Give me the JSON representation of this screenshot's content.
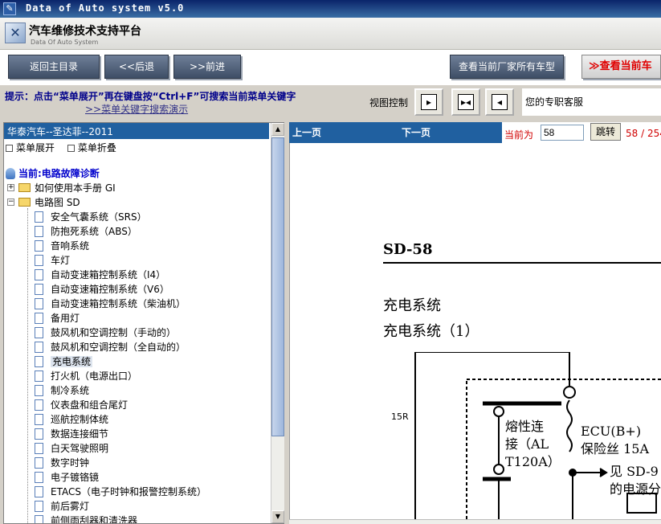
{
  "window": {
    "title": "Data of Auto system v5.0"
  },
  "header": {
    "title": "汽车维修技术支持平台",
    "subtitle": "Data Of Auto System"
  },
  "toolbar": {
    "home_label": "返回主目录",
    "back_label": "<<后退",
    "forward_label": ">>前进",
    "all_models_label": "查看当前厂家所有车型",
    "current_model_label": "查看当前车"
  },
  "hint": {
    "text": "提示：点击“菜单展开”再在键盘按“Ctrl+F”可搜索当前菜单关键字",
    "link": ">>菜单关键字搜索演示"
  },
  "view_control": {
    "label": "视图控制",
    "btn1": "▸",
    "btn2": "▸◂",
    "btn3": "◂"
  },
  "service_label": "您的专职客服",
  "left_panel": {
    "car_title": "华泰汽车--圣达菲--2011",
    "expand_label": "菜单展开",
    "collapse_label": "菜单折叠",
    "current_label": "当前:电路故障诊断",
    "nodes": [
      {
        "label": "如何使用本手册 GI"
      },
      {
        "label": "电路图 SD"
      }
    ],
    "items": [
      {
        "label": "安全气囊系统（SRS）"
      },
      {
        "label": "防抱死系统（ABS）"
      },
      {
        "label": "音响系统"
      },
      {
        "label": "车灯"
      },
      {
        "label": "自动变速箱控制系统（I4）"
      },
      {
        "label": "自动变速箱控制系统（V6）"
      },
      {
        "label": "自动变速箱控制系统（柴油机）"
      },
      {
        "label": "备用灯"
      },
      {
        "label": "鼓风机和空调控制（手动的）"
      },
      {
        "label": "鼓风机和空调控制（全自动的）"
      },
      {
        "label": "充电系统"
      },
      {
        "label": "打火机（电源出口）"
      },
      {
        "label": "制冷系统"
      },
      {
        "label": "仪表盘和组合尾灯"
      },
      {
        "label": "巡航控制体统"
      },
      {
        "label": "数据连接细节"
      },
      {
        "label": "白天驾驶照明"
      },
      {
        "label": "数字时钟"
      },
      {
        "label": "电子镀铬镜"
      },
      {
        "label": "ETACS（电子时钟和报警控制系统）"
      },
      {
        "label": "前后雾灯"
      },
      {
        "label": "前侧雨刮器和清洗器"
      }
    ]
  },
  "nav": {
    "prev_label": "上一页",
    "next_label": "下一页",
    "current_label": "当前为",
    "current_value": "58",
    "jump_label": "跳转",
    "page_count": "58 / 254"
  },
  "document": {
    "code": "SD-58",
    "system": "充电系统",
    "subtitle": "充电系统（1）",
    "labels": {
      "fuse_ref": "15R",
      "fusible": "熔性连",
      "fusible2": "接（AL",
      "fusible3": "T120A）",
      "ecu": "ECU(B+)",
      "fuse": "保险丝 15A",
      "see": "见 SD-9",
      "power": "的电源分"
    }
  }
}
